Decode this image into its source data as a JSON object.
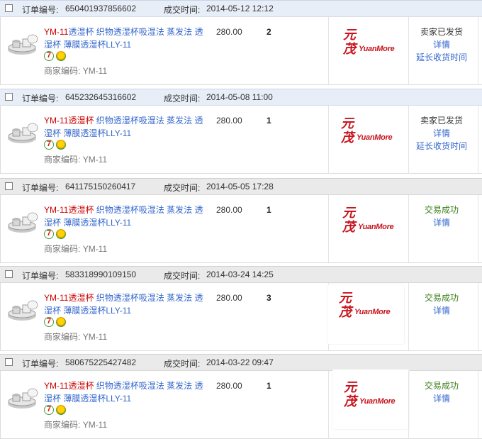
{
  "labels": {
    "order_no": "订单编号:",
    "deal_time": "成交时间:",
    "merchant_code": "商家编码:"
  },
  "orders": [
    {
      "order_no": "650401937856602",
      "deal_time": "2014-05-12 12:12",
      "title_red": "YM-11",
      "title_blue": "透湿杯  织物透湿杯吸湿法  蒸发法 透湿杯  薄膜透湿杯LLY-11",
      "merchant_code": "YM-11",
      "price": "280.00",
      "qty": "2",
      "status": "卖家已发货",
      "links": [
        "详情",
        "延长收货时间"
      ]
    },
    {
      "order_no": "645232645316602",
      "deal_time": "2014-05-08 11:00",
      "title_red": "YM-11透湿杯",
      "title_blue": "  织物透湿杯吸湿法  蒸发法 透湿杯  薄膜透湿杯LLY-11",
      "merchant_code": "YM-11",
      "price": "280.00",
      "qty": "1",
      "status": "卖家已发货",
      "links": [
        "详情",
        "延长收货时间"
      ]
    },
    {
      "order_no": "641175150260417",
      "deal_time": "2014-05-05 17:28",
      "title_red": "YM-11透湿杯",
      "title_blue": "  织物透湿杯吸湿法  蒸发法 透湿杯  薄膜透湿杯LLY-11",
      "merchant_code": "YM-11",
      "price": "280.00",
      "qty": "1",
      "status": "交易成功",
      "links": [
        "详情"
      ]
    },
    {
      "order_no": "583318990109150",
      "deal_time": "2014-03-24 14:25",
      "title_red": "YM-11透湿杯",
      "title_blue": "  织物透湿杯吸湿法  蒸发法 透湿杯  薄膜透湿杯LLY-11",
      "merchant_code": "YM-11",
      "price": "280.00",
      "qty": "3",
      "status": "交易成功",
      "links": [
        "详情"
      ]
    },
    {
      "order_no": "580675225427482",
      "deal_time": "2014-03-22 09:47",
      "title_red": "YM-11透湿杯",
      "title_blue": "  织物透湿杯吸湿法  蒸发法 透湿杯  薄膜透湿杯LLY-11",
      "merchant_code": "YM-11",
      "price": "280.00",
      "qty": "1",
      "status": "交易成功",
      "links": [
        "详情"
      ]
    }
  ],
  "brand": {
    "cn": "元茂",
    "en": "YuanMore"
  },
  "colors": {
    "status_shipped": "#333333",
    "status_success": "#3a7d17",
    "link": "#3366cc",
    "title_red": "#cc0000"
  }
}
